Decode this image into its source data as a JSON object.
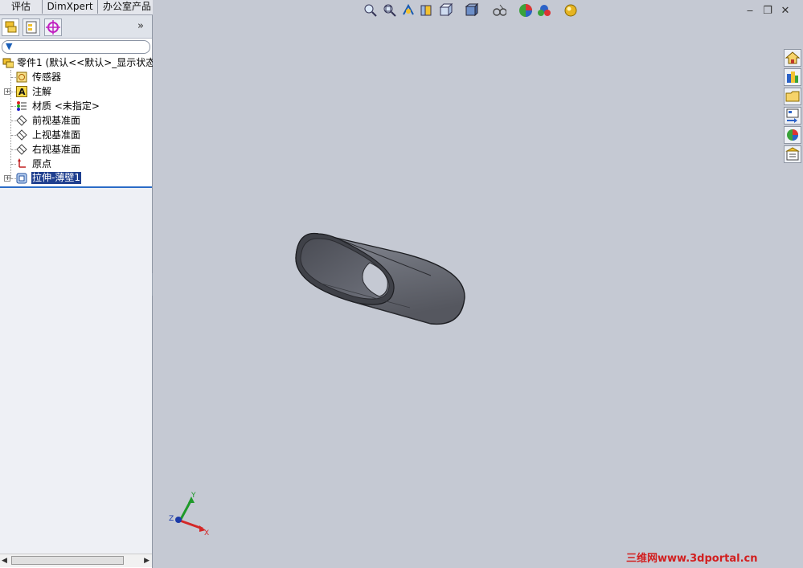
{
  "tabs": [
    {
      "label": "评估"
    },
    {
      "label": "DimXpert"
    },
    {
      "label": "办公室产品"
    }
  ],
  "panel": {
    "expand_label": "»",
    "filter_icon": "filter-icon"
  },
  "tree": {
    "root": "零件1  (默认<<默认>_显示状态",
    "items": [
      {
        "label": "传感器",
        "icon": "sensor-icon",
        "expandable": false
      },
      {
        "label": "注解",
        "icon": "annotation-icon",
        "expandable": true
      },
      {
        "label": "材质 <未指定>",
        "icon": "material-icon",
        "expandable": false
      },
      {
        "label": "前视基准面",
        "icon": "plane-icon",
        "expandable": false
      },
      {
        "label": "上视基准面",
        "icon": "plane-icon",
        "expandable": false
      },
      {
        "label": "右视基准面",
        "icon": "plane-icon",
        "expandable": false
      },
      {
        "label": "原点",
        "icon": "origin-icon",
        "expandable": false
      },
      {
        "label": "拉伸-薄壁1",
        "icon": "extrude-icon",
        "expandable": true,
        "selected": true
      }
    ]
  },
  "triad": {
    "x": "X",
    "y": "Y",
    "z": "Z"
  },
  "watermark": "三维网www.3dportal.cn",
  "colors": {
    "viewport": "#c5c9d3",
    "selection": "#1f3f8f",
    "accent": "#2a6bc6"
  }
}
